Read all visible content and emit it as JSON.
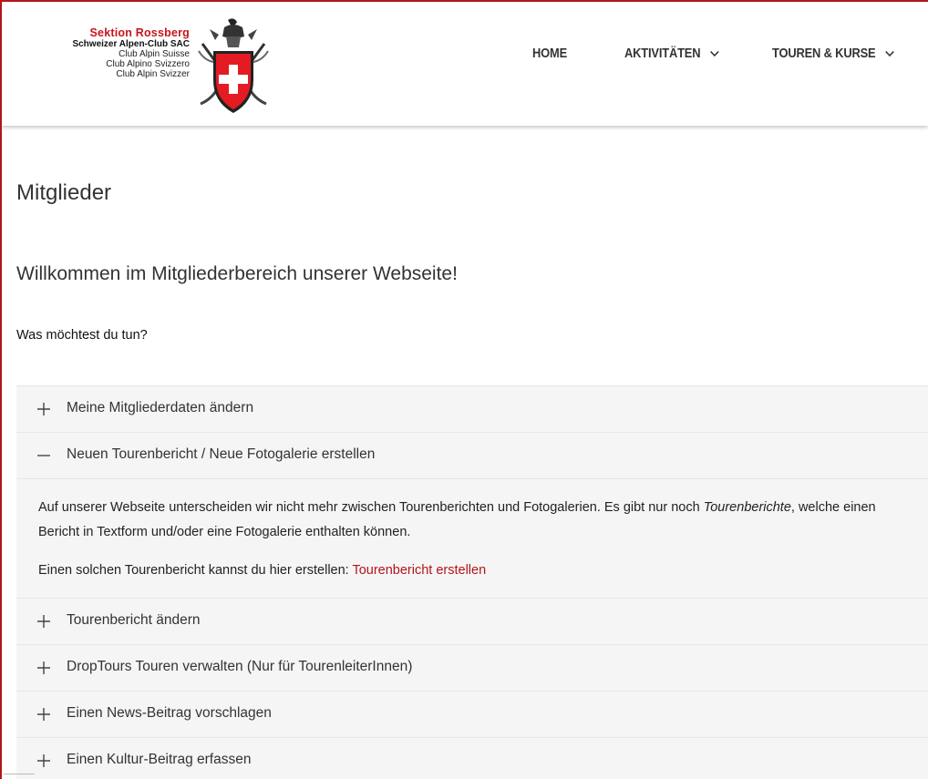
{
  "logo": {
    "title": "Sektion Rossberg",
    "club_sac": "Schweizer Alpen-Club SAC",
    "lines": [
      "Club Alpin Suisse",
      "Club Alpino Svizzero",
      "Club Alpin Svizzer"
    ]
  },
  "nav": {
    "home": "HOME",
    "aktivitaeten": "AKTIVITÄTEN",
    "touren_kurse": "TOUREN & KURSE"
  },
  "main": {
    "title": "Mitglieder",
    "welcome": "Willkommen im Mitgliederbereich unserer Webseite!",
    "question": "Was möchtest du tun?"
  },
  "accordion": {
    "items": [
      {
        "label": "Meine Mitgliederdaten ändern",
        "expanded": false
      },
      {
        "label": "Neuen Tourenbericht / Neue Fotogalerie erstellen",
        "expanded": true
      },
      {
        "label": "Tourenbericht ändern",
        "expanded": false
      },
      {
        "label": "DropTours Touren verwalten (Nur für TourenleiterInnen)",
        "expanded": false
      },
      {
        "label": "Einen News-Beitrag vorschlagen",
        "expanded": false
      },
      {
        "label": "Einen Kultur-Beitrag erfassen",
        "expanded": false
      }
    ],
    "body": {
      "p1_text": "Auf unserer Webseite unterscheiden wir nicht mehr zwischen Tourenberichten und Fotogalerien. Es gibt nur noch ",
      "p1_em": "Tourenberichte",
      "p1_tail": ", welche einen Bericht in Textform und/oder eine Fotogalerie enthalten können.",
      "p2_text": "Einen solchen Tourenbericht kannst du hier erstellen: ",
      "p2_link": "Tourenbericht erstellen"
    }
  },
  "colors": {
    "brand_red": "#b4141c",
    "accordion_bg": "#f5f5f5",
    "text": "#333333"
  },
  "icons": [
    "sac-emblem-icon",
    "chevron-down-icon",
    "plus-icon",
    "minus-icon"
  ]
}
